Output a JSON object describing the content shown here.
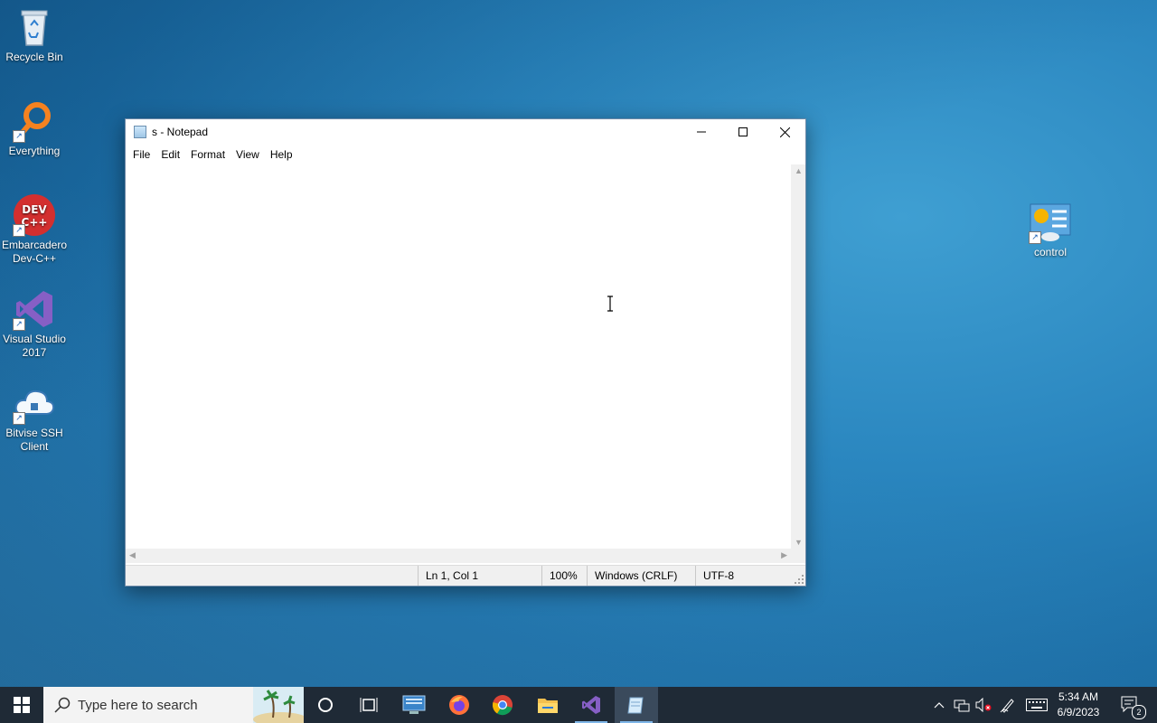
{
  "desktop": {
    "icons": [
      {
        "label": "Recycle Bin",
        "icon": "recycle-bin-icon"
      },
      {
        "label": "Everything",
        "icon": "search-magnifier-icon"
      },
      {
        "label": "Embarcadero Dev-C++",
        "icon": "devcpp-icon"
      },
      {
        "label": "Visual Studio 2017",
        "icon": "visual-studio-icon"
      },
      {
        "label": "Bitvise SSH Client",
        "icon": "bitvise-ssh-icon"
      },
      {
        "label": "control",
        "icon": "control-panel-icon"
      }
    ]
  },
  "window": {
    "title": "s - Notepad",
    "menu": [
      "File",
      "Edit",
      "Format",
      "View",
      "Help"
    ],
    "content": "",
    "status": {
      "position": "Ln 1, Col 1",
      "zoom": "100%",
      "line_ending": "Windows (CRLF)",
      "encoding": "UTF-8"
    }
  },
  "taskbar": {
    "search_placeholder": "Type here to search",
    "apps": [
      "cortana-icon",
      "task-view-icon",
      "remote-desktop-icon",
      "firefox-icon",
      "chrome-icon",
      "file-explorer-icon",
      "visual-studio-icon",
      "notepad-icon"
    ],
    "clock": {
      "time": "5:34 AM",
      "date": "6/9/2023"
    },
    "notifications_count": "2"
  },
  "colors": {
    "taskbar": "#1f2a36",
    "desktop": "#2a86bf",
    "accent": "#0078d7"
  }
}
